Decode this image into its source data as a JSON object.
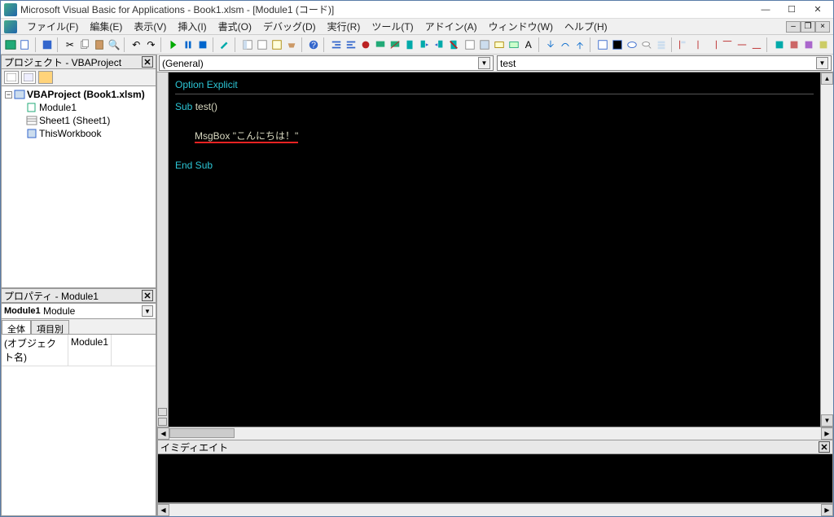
{
  "window": {
    "title": "Microsoft Visual Basic for Applications - Book1.xlsm - [Module1 (コード)]"
  },
  "menu": [
    "ファイル(F)",
    "編集(E)",
    "表示(V)",
    "挿入(I)",
    "書式(O)",
    "デバッグ(D)",
    "実行(R)",
    "ツール(T)",
    "アドイン(A)",
    "ウィンドウ(W)",
    "ヘルプ(H)"
  ],
  "project_pane": {
    "title": "プロジェクト - VBAProject",
    "root": "VBAProject (Book1.xlsm)",
    "children": [
      "Module1",
      "Sheet1 (Sheet1)",
      "ThisWorkbook"
    ]
  },
  "properties_pane": {
    "title": "プロパティ - Module1",
    "object_name": "Module1",
    "object_type": "Module",
    "tabs": [
      "全体",
      "項目別"
    ],
    "rows": [
      {
        "k": "(オブジェクト名)",
        "v": "Module1"
      }
    ]
  },
  "code_combo": {
    "left": "(General)",
    "right": "test"
  },
  "code": {
    "option": "Option Explicit",
    "sub_kw": "Sub ",
    "sub_name": "test()",
    "msgbox": "MsgBox ",
    "str": "\"こんにちは！\"",
    "end": "End Sub"
  },
  "immediate": {
    "title": "イミディエイト"
  }
}
